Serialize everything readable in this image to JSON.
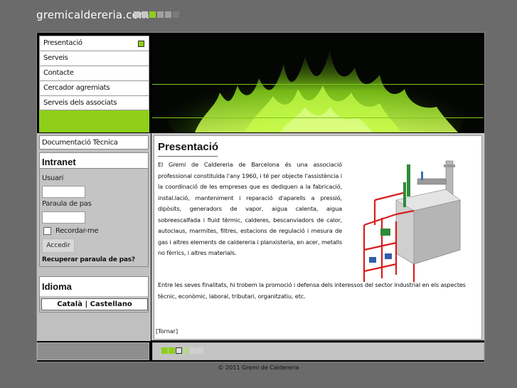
{
  "site": {
    "title": "gremicaldereria.com",
    "squares": [
      "#c8c8c8",
      "#c8c8c8",
      "#8fcf1a",
      "#a0a0a0",
      "#a0a0a0",
      "#7a7a7a"
    ]
  },
  "nav": {
    "items": [
      {
        "label": "Presentació",
        "active": true
      },
      {
        "label": "Serveis"
      },
      {
        "label": "Contacte"
      },
      {
        "label": "Cercador agremiats"
      },
      {
        "label": "Serveis dels associats"
      }
    ]
  },
  "sidebar": {
    "doc_tecnica": "Documentació Tècnica",
    "intranet": {
      "title": "Intranet",
      "user_label": "Usuari",
      "pass_label": "Paraula de pas",
      "remember_label": "Recordar-me",
      "submit_label": "Accedir",
      "recover_label": "Recuperar paraula de pas?"
    },
    "idioma": {
      "title": "Idioma",
      "catala": "Català",
      "separator": " | ",
      "castellano": "Castellano"
    }
  },
  "main": {
    "title": "Presentació",
    "paragraph1": "El Gremi de Caldereria de Barcelona és una associació professional constituïda l'any 1960, i té per objecte l'assistència i la coordinació de les empreses que es dediquen a la fabricació, instal.lació, manteniment i reparació d'aparells a pressió, dipòsits, generadors de vapor, aigua calenta, aigua sobreescalfada i fluid tèrmic, calderes, bescanviadors de calor, autoclaus, marmites, filtres, estacions de regulació i mesura de gas i altres elements de caldereria i planxisteria, en acer, metalls no fèrrics, i altres materials.",
    "paragraph2": "Entre les seves finalitats, hi trobem la promoció i defensa dels interessos del sector industrial en els aspectes tècnic, econòmic, laboral, tributari, organitzatiu, etc.",
    "back_link": "[Tornar]"
  },
  "footer": {
    "squares": [
      "#8fcf1a",
      "#8fcf1a",
      "#e0e0e0",
      "#b8d890",
      "#d0d0d0",
      "#d0d0d0"
    ],
    "copyright": "© 2011 Gremi de Caldereria"
  },
  "colors": {
    "accent": "#8fcf1a",
    "background": "#6b6b6b"
  }
}
